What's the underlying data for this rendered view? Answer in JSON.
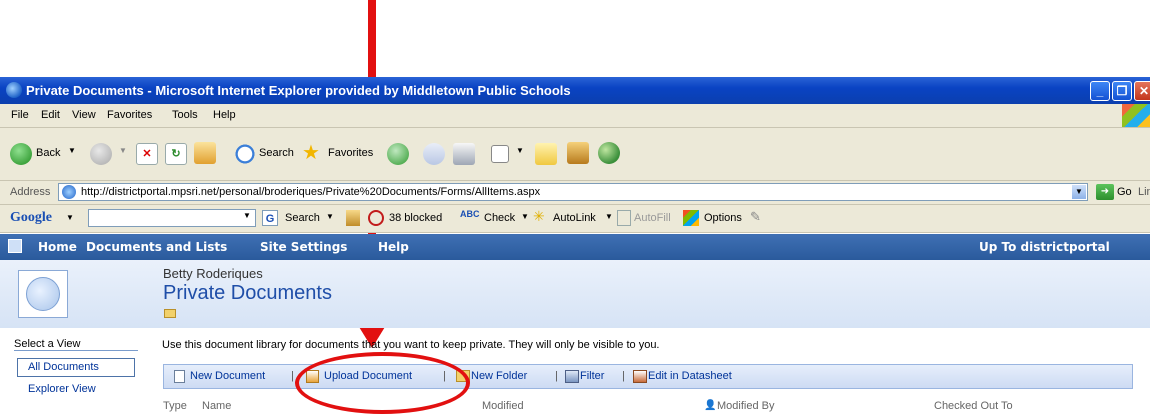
{
  "window": {
    "title": "Private Documents - Microsoft Internet Explorer provided by Middletown Public Schools",
    "buttons": [
      "_",
      "❐",
      "✕"
    ]
  },
  "menu": [
    "File",
    "Edit",
    "View",
    "Favorites",
    "Tools",
    "Help"
  ],
  "toolbar": {
    "back_label": "Back",
    "search_label": "Search",
    "favorites_label": "Favorites"
  },
  "addressbar": {
    "label": "Address",
    "url": "http://districtportal.mpsri.net/personal/broderiques/Private%20Documents/Forms/AllItems.aspx",
    "go_label": "Go",
    "links_label": "Links"
  },
  "googlebar": {
    "logo": "Google",
    "search_label": "Search",
    "blocked_label": "38 blocked",
    "check_label": "Check",
    "autolink_label": "AutoLink",
    "autofill_label": "AutoFill",
    "options_label": "Options"
  },
  "sp_nav": {
    "items": [
      "Home",
      "Documents and Lists",
      "Site Settings",
      "Help"
    ],
    "up_to": "Up To districtportal"
  },
  "sp_header": {
    "owner": "Betty Roderiques",
    "title": "Private Documents"
  },
  "sidebar": {
    "select_view": "Select a View",
    "views": [
      "All Documents",
      "Explorer View"
    ]
  },
  "library": {
    "description": "Use this document library for documents that you want to keep private.  They will only be visible to you.",
    "actions": [
      "New Document",
      "Upload Document",
      "New Folder",
      "Filter",
      "Edit in Datasheet"
    ],
    "columns": [
      "Type",
      "Name",
      "Modified",
      "Modified By",
      "Checked Out To"
    ]
  },
  "colors": {
    "annotation": "#e21010",
    "titlebar": "#0a43c3",
    "sp_nav": "#2a5a9c"
  }
}
